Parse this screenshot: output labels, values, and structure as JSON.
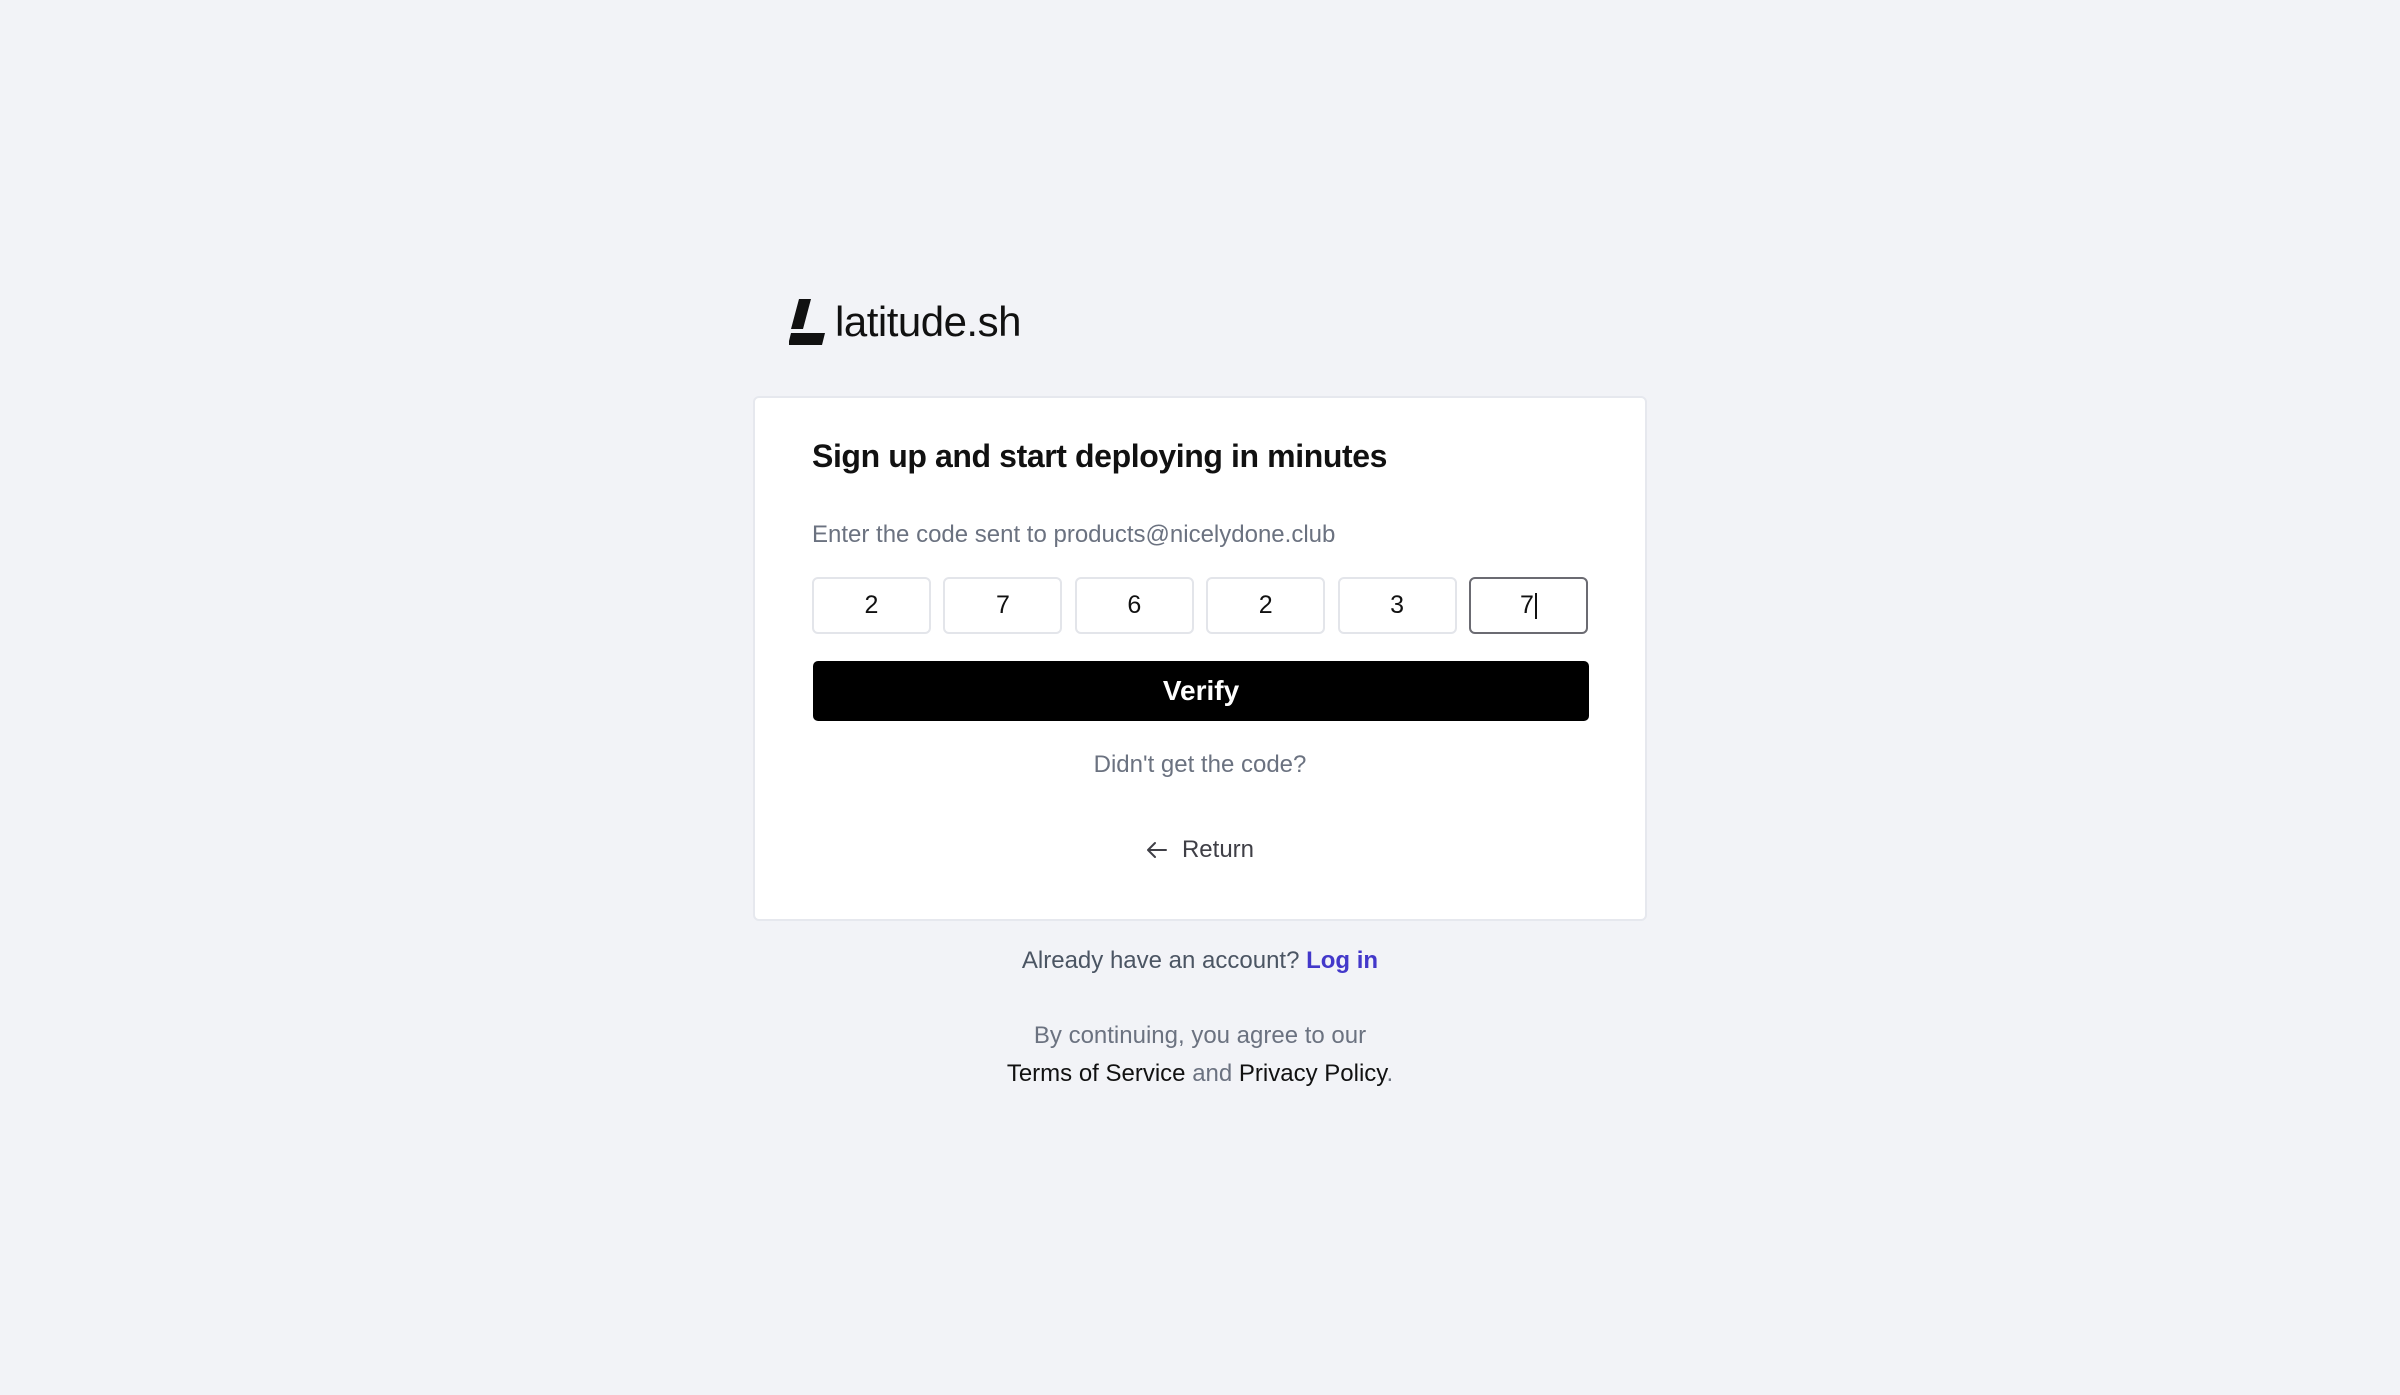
{
  "brand": {
    "name": "latitude.sh"
  },
  "card": {
    "title": "Sign up and start deploying in minutes",
    "subtitle": "Enter the code sent to products@nicelydone.club",
    "otp": [
      "2",
      "7",
      "6",
      "2",
      "3",
      "7"
    ],
    "verify_label": "Verify",
    "resend_label": "Didn't get the code?",
    "return_label": "Return"
  },
  "footer": {
    "account_prompt": "Already have an account?",
    "login_label": "Log in",
    "terms_intro": "By continuing, you agree to our",
    "terms_label": "Terms of Service",
    "and_label": "and",
    "privacy_label": "Privacy Policy",
    "period": "."
  },
  "colors": {
    "background": "#f2f3f7",
    "primary_button": "#000000",
    "link": "#4338ca"
  },
  "icons": {
    "logo": "latitude-logo-icon",
    "return": "arrow-left-icon"
  }
}
